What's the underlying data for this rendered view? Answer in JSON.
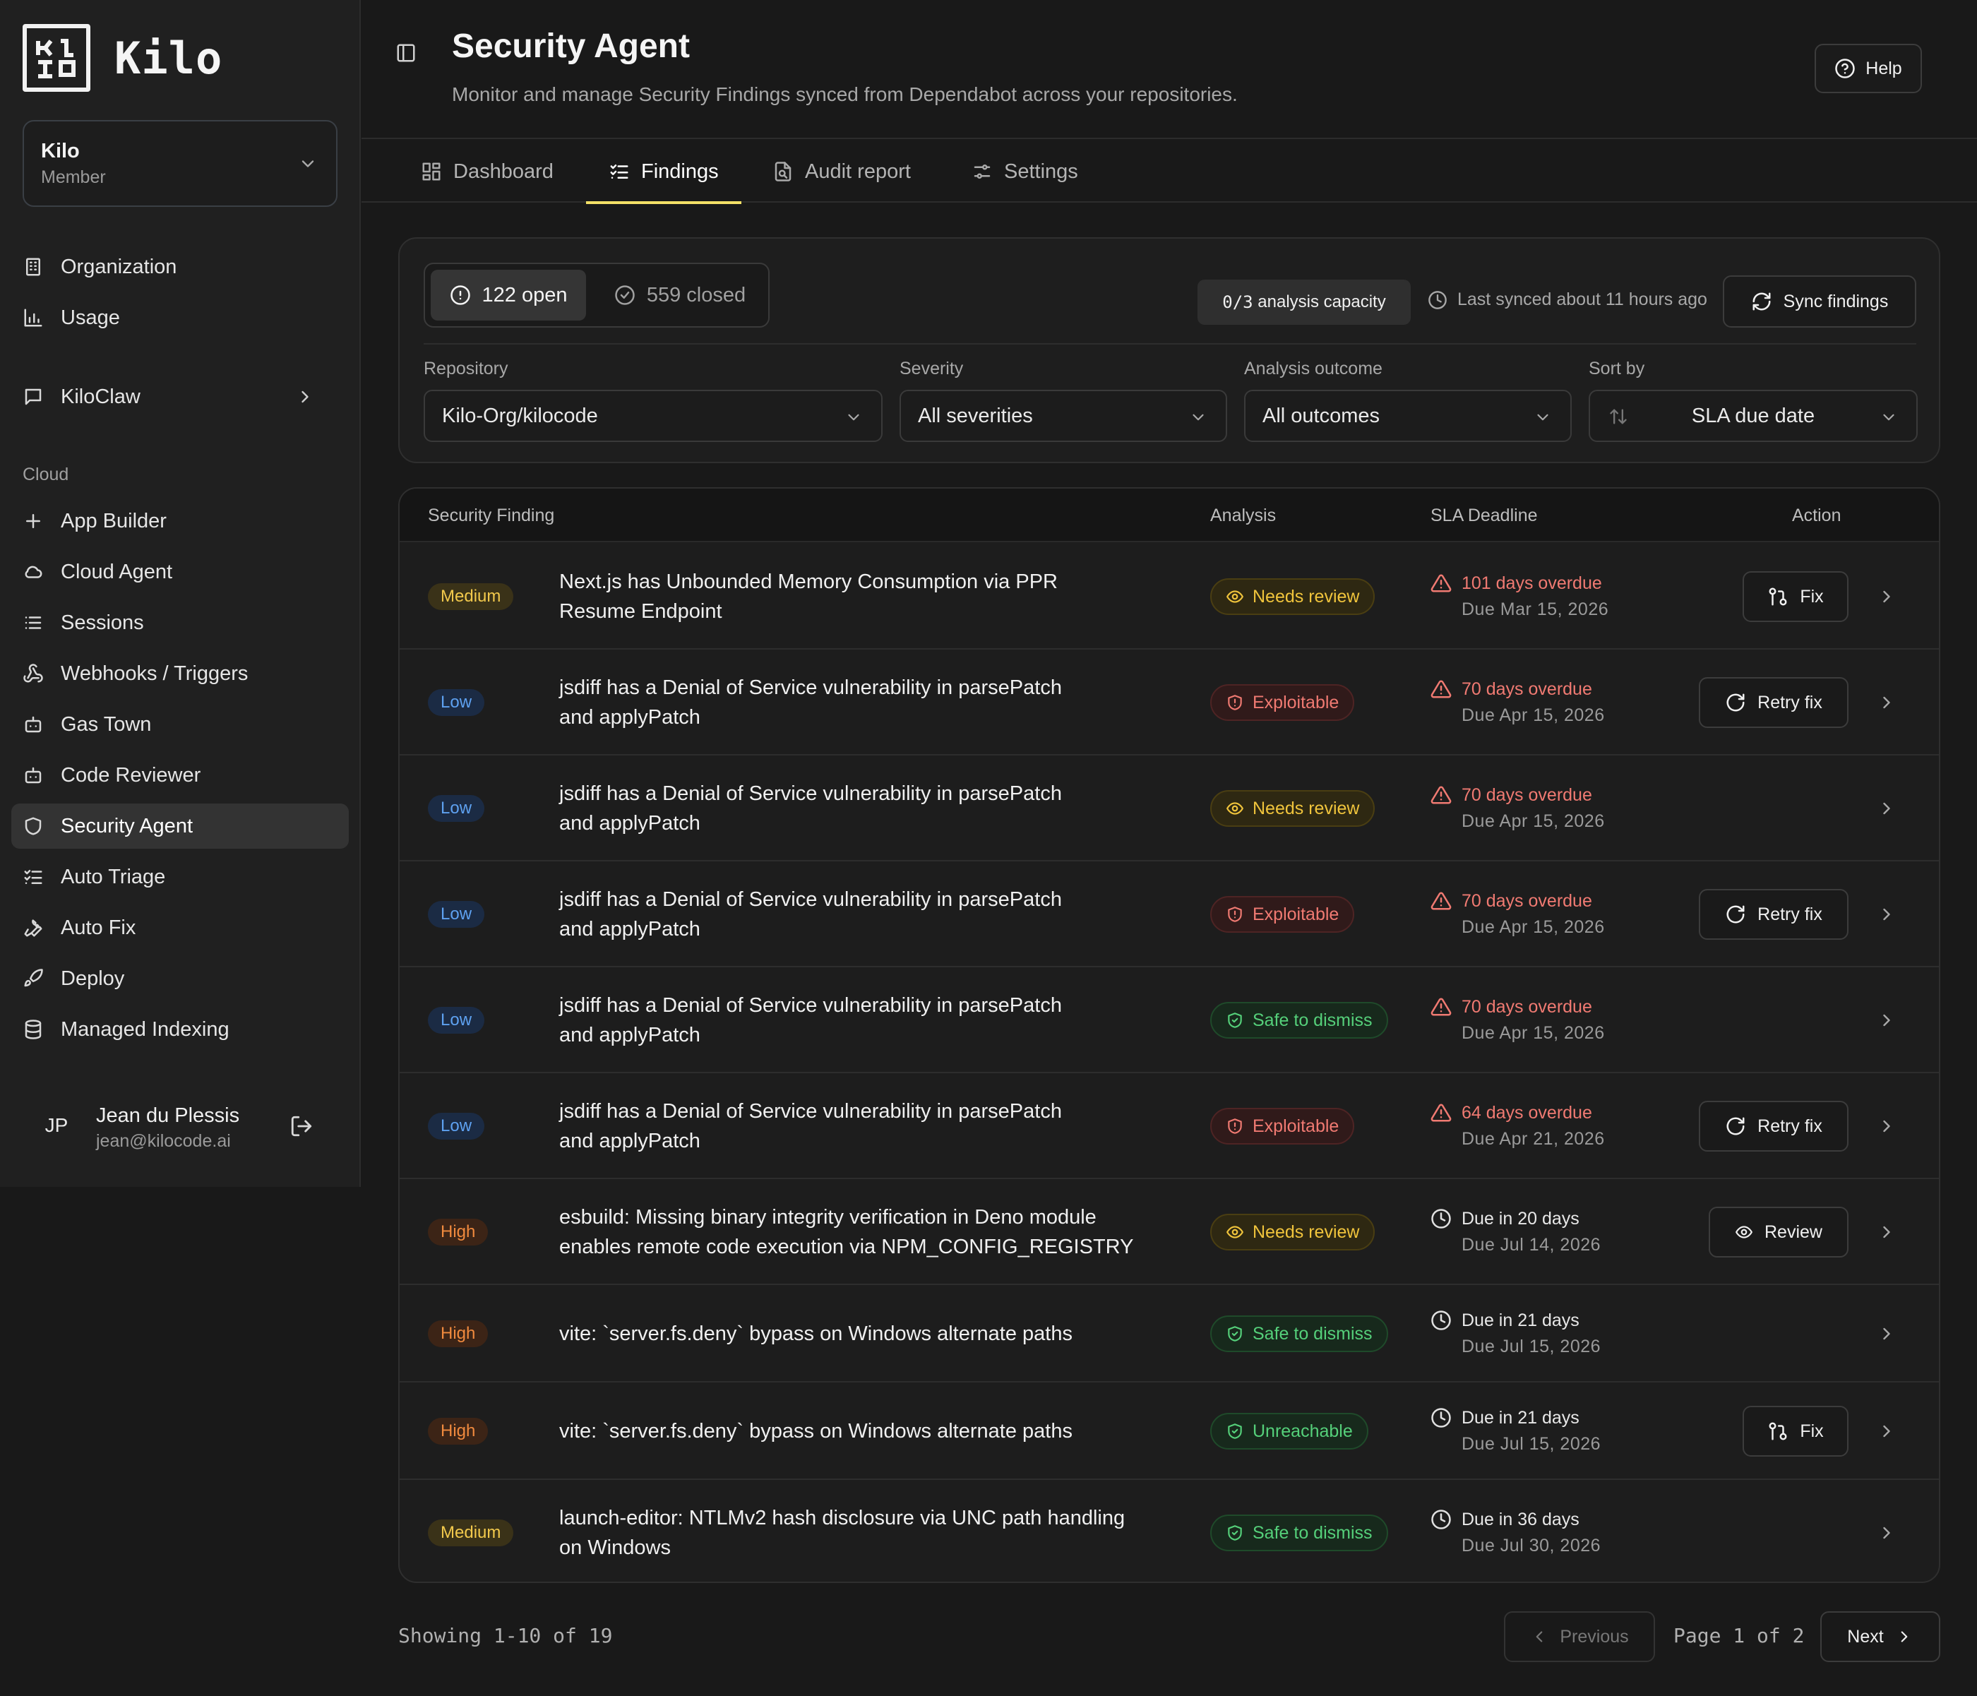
{
  "app": {
    "logo_text": "Kilo"
  },
  "org": {
    "name": "Kilo",
    "role": "Member"
  },
  "nav": {
    "items_top": [
      "Organization",
      "Usage"
    ],
    "kiloclaw": "KiloClaw",
    "cloud_label": "Cloud",
    "cloud_items": [
      "App Builder",
      "Cloud Agent",
      "Sessions",
      "Webhooks / Triggers",
      "Gas Town",
      "Code Reviewer",
      "Security Agent",
      "Auto Triage",
      "Auto Fix",
      "Deploy",
      "Managed Indexing"
    ],
    "active": "Security Agent"
  },
  "user": {
    "initials": "JP",
    "name": "Jean du Plessis",
    "email": "jean@kilocode.ai"
  },
  "header": {
    "title": "Security Agent",
    "subtitle": "Monitor and manage Security Findings synced from Dependabot across your repositories.",
    "help_label": "Help"
  },
  "tabs": [
    {
      "label": "Dashboard",
      "icon": "dashboard-icon"
    },
    {
      "label": "Findings",
      "icon": "list-check-icon",
      "active": true
    },
    {
      "label": "Audit report",
      "icon": "file-audit-icon"
    },
    {
      "label": "Settings",
      "icon": "sliders-icon"
    }
  ],
  "toolbar": {
    "open_label": "122 open",
    "closed_label": "559 closed",
    "capacity_value": "0/3",
    "capacity_text": "analysis capacity",
    "last_synced": "Last synced about 11 hours ago",
    "sync_label": "Sync findings"
  },
  "filters": {
    "repository": {
      "label": "Repository",
      "value": "Kilo-Org/kilocode"
    },
    "severity": {
      "label": "Severity",
      "value": "All severities"
    },
    "outcome": {
      "label": "Analysis outcome",
      "value": "All outcomes"
    },
    "sort": {
      "label": "Sort by",
      "value": "SLA due date"
    }
  },
  "table": {
    "headers": {
      "finding": "Security Finding",
      "analysis": "Analysis",
      "sla": "SLA Deadline",
      "action": "Action"
    },
    "rows": [
      {
        "severity": "Medium",
        "title1": "Next.js has Unbounded Memory Consumption via PPR",
        "title2": "Resume Endpoint",
        "analysis": "Needs review",
        "sla_top": "101 days overdue",
        "sla_bot": "Due Mar 15, 2026",
        "action": "Fix"
      },
      {
        "severity": "Low",
        "title1": "jsdiff has a Denial of Service vulnerability in parsePatch",
        "title2": "and applyPatch",
        "analysis": "Exploitable",
        "sla_top": "70 days overdue",
        "sla_bot": "Due Apr 15, 2026",
        "action": "Retry fix"
      },
      {
        "severity": "Low",
        "title1": "jsdiff has a Denial of Service vulnerability in parsePatch",
        "title2": "and applyPatch",
        "analysis": "Needs review",
        "sla_top": "70 days overdue",
        "sla_bot": "Due Apr 15, 2026",
        "action": ""
      },
      {
        "severity": "Low",
        "title1": "jsdiff has a Denial of Service vulnerability in parsePatch",
        "title2": "and applyPatch",
        "analysis": "Exploitable",
        "sla_top": "70 days overdue",
        "sla_bot": "Due Apr 15, 2026",
        "action": "Retry fix"
      },
      {
        "severity": "Low",
        "title1": "jsdiff has a Denial of Service vulnerability in parsePatch",
        "title2": "and applyPatch",
        "analysis": "Safe to dismiss",
        "sla_top": "70 days overdue",
        "sla_bot": "Due Apr 15, 2026",
        "action": ""
      },
      {
        "severity": "Low",
        "title1": "jsdiff has a Denial of Service vulnerability in parsePatch",
        "title2": "and applyPatch",
        "analysis": "Exploitable",
        "sla_top": "64 days overdue",
        "sla_bot": "Due Apr 21, 2026",
        "action": "Retry fix"
      },
      {
        "severity": "High",
        "title1": "esbuild: Missing binary integrity verification in Deno module",
        "title2": "enables remote code execution via NPM_CONFIG_REGISTRY",
        "analysis": "Needs review",
        "sla_top": "Due in 20 days",
        "sla_bot": "Due Jul 14, 2026",
        "action": "Review"
      },
      {
        "severity": "High",
        "title1": "vite: `server.fs.deny` bypass on Windows alternate paths",
        "title2": "",
        "analysis": "Safe to dismiss",
        "sla_top": "Due in 21 days",
        "sla_bot": "Due Jul 15, 2026",
        "action": ""
      },
      {
        "severity": "High",
        "title1": "vite: `server.fs.deny` bypass on Windows alternate paths",
        "title2": "",
        "analysis": "Unreachable",
        "sla_top": "Due in 21 days",
        "sla_bot": "Due Jul 15, 2026",
        "action": "Fix"
      },
      {
        "severity": "Medium",
        "title1": "launch-editor: NTLMv2 hash disclosure via UNC path handling",
        "title2": "on Windows",
        "analysis": "Safe to dismiss",
        "sla_top": "Due in 36 days",
        "sla_bot": "Due Jul 30, 2026",
        "action": ""
      }
    ]
  },
  "pagination": {
    "showing": "Showing 1-10 of 19",
    "previous": "Previous",
    "page": "Page 1 of 2",
    "next": "Next"
  },
  "colors": {
    "accent": "#f3e066",
    "overdue": "#f07a72",
    "safe": "#55d07a",
    "review": "#f0c43c",
    "low": "#5ea1f0",
    "high": "#f08a3e"
  }
}
